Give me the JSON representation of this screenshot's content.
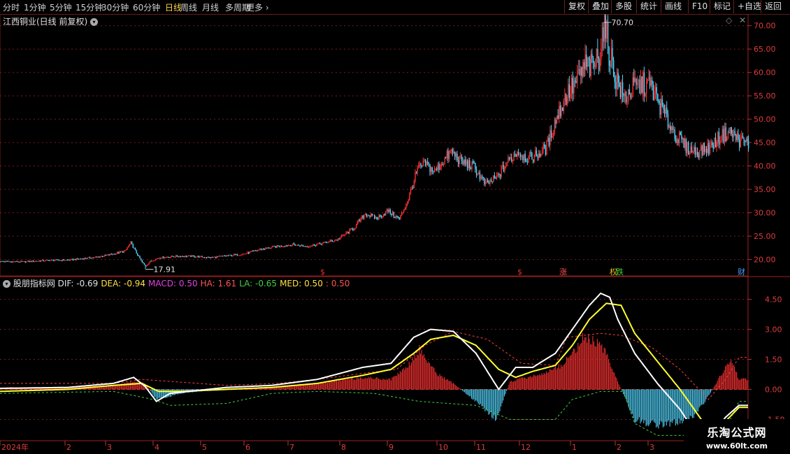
{
  "toolbar": {
    "timeframes": [
      "分时",
      "1分钟",
      "5分钟",
      "15分钟",
      "30分钟",
      "60分钟",
      "日线",
      "周线",
      "月线",
      "多周期",
      "更多"
    ],
    "active": "日线",
    "right_buttons": [
      "复权",
      "叠加",
      "多股",
      "统计",
      "画线",
      "F10",
      "标记",
      "+自选",
      "返回"
    ]
  },
  "main_panel": {
    "title": "江西铜业(日线 前复权)",
    "high_label": "70.70",
    "low_label": "17.91",
    "price_ticks": [
      "70.00",
      "65.00",
      "60.00",
      "55.00",
      "50.00",
      "45.00",
      "40.00",
      "35.00",
      "30.00",
      "25.00",
      "20.00"
    ],
    "markers": [
      {
        "text": "$",
        "color": "#e03030"
      },
      {
        "text": "$",
        "color": "#e03030"
      },
      {
        "text": "涨",
        "color": "#ff5050"
      },
      {
        "text": "权",
        "color": "#e0c020"
      },
      {
        "text": "跌",
        "color": "#40d040"
      },
      {
        "text": "财",
        "color": "#40a0ff"
      }
    ]
  },
  "indicator_panel": {
    "name": "股朋指标网",
    "readouts": [
      {
        "label": "DIF:",
        "value": "-0.69",
        "color": "#e0e0e0"
      },
      {
        "label": "DEA:",
        "value": "-0.94",
        "color": "#ffe040"
      },
      {
        "label": "MACD:",
        "value": "0.50",
        "color": "#e040e0"
      },
      {
        "label": "HA:",
        "value": "1.61",
        "color": "#ff5050"
      },
      {
        "label": "LA:",
        "value": "-0.65",
        "color": "#40d040"
      },
      {
        "label": "MED:",
        "value": "0.50",
        "color": "#ffe040"
      },
      {
        "label": ":",
        "value": "0.50",
        "color": "#ff5050"
      }
    ],
    "ticks": [
      "4.50",
      "3.00",
      "1.50",
      "0.00",
      "-1.50"
    ]
  },
  "x_axis": {
    "labels": [
      "2024年",
      "2",
      "3",
      "4",
      "5",
      "6",
      "7",
      "8",
      "9",
      "10",
      "11",
      "12",
      "1",
      "2",
      "3"
    ]
  },
  "watermark": {
    "title": "乐淘公式网",
    "url": "www.60lt.com"
  },
  "colors": {
    "up": "#ff3232",
    "down": "#54d7ff",
    "dif": "#ffffff",
    "dea": "#ffff30",
    "ha": "#ff4040",
    "la": "#40d040",
    "grid": "#7a1a1a"
  },
  "chart_data": {
    "type": "candlestick",
    "y_range": [
      16.5,
      72.5
    ],
    "price_anchors": [
      [
        0,
        19.6
      ],
      [
        20,
        19.5
      ],
      [
        40,
        19.8
      ],
      [
        60,
        19.9
      ],
      [
        85,
        20.5
      ],
      [
        100,
        21.2
      ],
      [
        110,
        21.8
      ],
      [
        115,
        23.6
      ],
      [
        120,
        21.4
      ],
      [
        125,
        19.4
      ],
      [
        128,
        18.6
      ],
      [
        132,
        19.6
      ],
      [
        140,
        20.4
      ],
      [
        155,
        20.7
      ],
      [
        170,
        20.7
      ],
      [
        185,
        20.4
      ],
      [
        200,
        20.8
      ],
      [
        215,
        21.2
      ],
      [
        230,
        22.2
      ],
      [
        245,
        22.8
      ],
      [
        258,
        23.2
      ],
      [
        270,
        22.8
      ],
      [
        285,
        23.5
      ],
      [
        298,
        24.3
      ],
      [
        312,
        26.8
      ],
      [
        322,
        29.8
      ],
      [
        332,
        28.8
      ],
      [
        342,
        30.4
      ],
      [
        352,
        28.6
      ],
      [
        360,
        33.0
      ],
      [
        368,
        39.2
      ],
      [
        375,
        40.5
      ],
      [
        383,
        38.8
      ],
      [
        392,
        41.5
      ],
      [
        398,
        43.0
      ],
      [
        406,
        41.0
      ],
      [
        418,
        39.8
      ],
      [
        428,
        36.0
      ],
      [
        438,
        37.5
      ],
      [
        446,
        40.4
      ],
      [
        456,
        43.2
      ],
      [
        466,
        41.5
      ],
      [
        476,
        42.8
      ],
      [
        482,
        44.0
      ],
      [
        490,
        50.0
      ],
      [
        500,
        55.5
      ],
      [
        508,
        57.8
      ],
      [
        516,
        61.5
      ],
      [
        522,
        61.0
      ],
      [
        528,
        63.5
      ],
      [
        532,
        70.0
      ],
      [
        536,
        66.0
      ],
      [
        542,
        59.5
      ],
      [
        550,
        54.5
      ],
      [
        558,
        56.5
      ],
      [
        566,
        57.5
      ],
      [
        574,
        57.0
      ],
      [
        580,
        54.0
      ],
      [
        588,
        50.0
      ],
      [
        596,
        46.5
      ],
      [
        606,
        43.8
      ],
      [
        614,
        43.0
      ],
      [
        626,
        44.0
      ],
      [
        636,
        46.5
      ],
      [
        644,
        47.2
      ],
      [
        652,
        45.5
      ],
      [
        660,
        44.8
      ]
    ],
    "indicator": {
      "y_range": [
        -2.6,
        5.6
      ],
      "dif_anchors": [
        [
          0,
          0.05
        ],
        [
          60,
          0.1
        ],
        [
          100,
          0.3
        ],
        [
          118,
          0.6
        ],
        [
          128,
          0.15
        ],
        [
          138,
          -0.6
        ],
        [
          150,
          -0.2
        ],
        [
          200,
          0.1
        ],
        [
          240,
          0.2
        ],
        [
          280,
          0.5
        ],
        [
          320,
          1.1
        ],
        [
          345,
          1.3
        ],
        [
          365,
          2.6
        ],
        [
          380,
          3.0
        ],
        [
          400,
          2.9
        ],
        [
          420,
          1.8
        ],
        [
          440,
          0.0
        ],
        [
          455,
          1.1
        ],
        [
          470,
          1.1
        ],
        [
          490,
          1.8
        ],
        [
          505,
          3.0
        ],
        [
          520,
          4.2
        ],
        [
          530,
          4.8
        ],
        [
          538,
          4.6
        ],
        [
          545,
          3.5
        ],
        [
          560,
          1.8
        ],
        [
          580,
          0.3
        ],
        [
          600,
          -1.0
        ],
        [
          615,
          -2.3
        ],
        [
          625,
          -2.5
        ],
        [
          640,
          -1.4
        ],
        [
          652,
          -0.8
        ]
      ],
      "dea_anchors": [
        [
          0,
          -0.1
        ],
        [
          60,
          0.0
        ],
        [
          100,
          0.2
        ],
        [
          125,
          0.3
        ],
        [
          140,
          -0.1
        ],
        [
          160,
          -0.1
        ],
        [
          200,
          0.0
        ],
        [
          240,
          0.1
        ],
        [
          280,
          0.3
        ],
        [
          320,
          0.7
        ],
        [
          345,
          1.0
        ],
        [
          365,
          1.8
        ],
        [
          380,
          2.5
        ],
        [
          400,
          2.7
        ],
        [
          420,
          2.2
        ],
        [
          440,
          1.0
        ],
        [
          455,
          0.6
        ],
        [
          470,
          0.9
        ],
        [
          490,
          1.2
        ],
        [
          505,
          2.2
        ],
        [
          520,
          3.5
        ],
        [
          535,
          4.3
        ],
        [
          548,
          4.2
        ],
        [
          560,
          2.8
        ],
        [
          580,
          1.4
        ],
        [
          600,
          0.0
        ],
        [
          615,
          -1.2
        ],
        [
          625,
          -2.0
        ],
        [
          640,
          -1.6
        ],
        [
          652,
          -0.9
        ]
      ],
      "ha_anchors": [
        [
          0,
          0.3
        ],
        [
          100,
          0.3
        ],
        [
          125,
          0.5
        ],
        [
          200,
          0.2
        ],
        [
          245,
          0.3
        ],
        [
          280,
          0.5
        ],
        [
          320,
          0.8
        ],
        [
          350,
          1.0
        ],
        [
          375,
          2.2
        ],
        [
          400,
          2.9
        ],
        [
          430,
          2.5
        ],
        [
          460,
          1.3
        ],
        [
          490,
          1.2
        ],
        [
          500,
          2.6
        ],
        [
          530,
          2.8
        ],
        [
          548,
          2.7
        ],
        [
          575,
          2.1
        ],
        [
          600,
          1.0
        ],
        [
          625,
          -0.5
        ],
        [
          640,
          0.5
        ],
        [
          652,
          1.6
        ]
      ],
      "la_anchors": [
        [
          0,
          -0.2
        ],
        [
          100,
          -0.1
        ],
        [
          135,
          -0.5
        ],
        [
          150,
          -0.8
        ],
        [
          200,
          -0.7
        ],
        [
          240,
          -0.2
        ],
        [
          280,
          -0.1
        ],
        [
          330,
          -0.2
        ],
        [
          370,
          -0.6
        ],
        [
          420,
          -0.8
        ],
        [
          450,
          -1.5
        ],
        [
          490,
          -1.5
        ],
        [
          505,
          -0.5
        ],
        [
          530,
          -0.1
        ],
        [
          550,
          -0.1
        ],
        [
          560,
          -1.7
        ],
        [
          580,
          -2.3
        ],
        [
          600,
          -2.3
        ],
        [
          625,
          -2.3
        ],
        [
          640,
          -2.0
        ],
        [
          652,
          -0.6
        ]
      ],
      "macd_anchors": [
        [
          0,
          0.1
        ],
        [
          60,
          0.1
        ],
        [
          100,
          0.2
        ],
        [
          118,
          0.4
        ],
        [
          128,
          0.3
        ],
        [
          138,
          -0.5
        ],
        [
          160,
          -0.2
        ],
        [
          200,
          0.05
        ],
        [
          240,
          0.1
        ],
        [
          280,
          0.3
        ],
        [
          320,
          0.6
        ],
        [
          345,
          0.5
        ],
        [
          360,
          1.2
        ],
        [
          370,
          2.0
        ],
        [
          385,
          0.8
        ],
        [
          400,
          0.3
        ],
        [
          420,
          -0.6
        ],
        [
          438,
          -1.5
        ],
        [
          450,
          0.4
        ],
        [
          465,
          0.6
        ],
        [
          480,
          0.8
        ],
        [
          495,
          1.2
        ],
        [
          505,
          1.8
        ],
        [
          515,
          2.6
        ],
        [
          525,
          2.4
        ],
        [
          535,
          1.8
        ],
        [
          545,
          0.4
        ],
        [
          560,
          -1.5
        ],
        [
          580,
          -1.8
        ],
        [
          598,
          -1.6
        ],
        [
          610,
          -1.4
        ],
        [
          620,
          -0.8
        ],
        [
          635,
          0.6
        ],
        [
          645,
          1.5
        ],
        [
          652,
          0.5
        ]
      ]
    }
  }
}
